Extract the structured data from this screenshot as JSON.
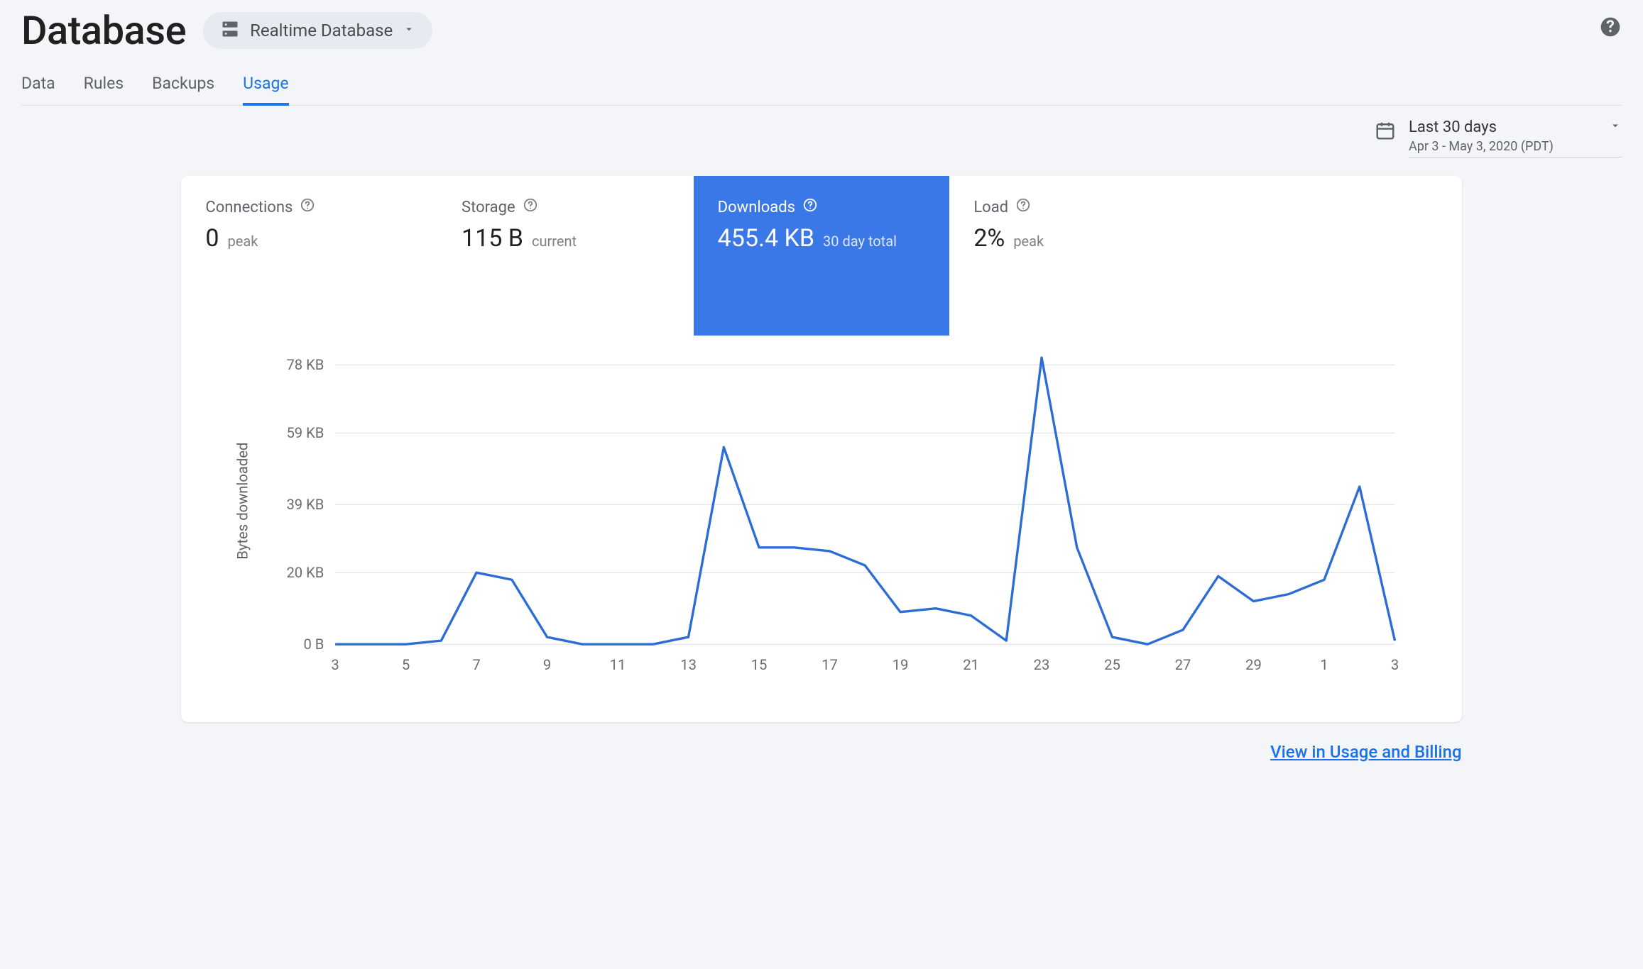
{
  "header": {
    "title": "Database",
    "picker_label": "Realtime Database"
  },
  "tabs": [
    {
      "label": "Data",
      "active": false
    },
    {
      "label": "Rules",
      "active": false
    },
    {
      "label": "Backups",
      "active": false
    },
    {
      "label": "Usage",
      "active": true
    }
  ],
  "date_range": {
    "main": "Last 30 days",
    "sub": "Apr 3 - May 3, 2020 (PDT)"
  },
  "metrics": [
    {
      "key": "connections",
      "label": "Connections",
      "value": "0",
      "sub": "peak",
      "selected": false
    },
    {
      "key": "storage",
      "label": "Storage",
      "value": "115 B",
      "sub": "current",
      "selected": false
    },
    {
      "key": "downloads",
      "label": "Downloads",
      "value": "455.4 KB",
      "sub": "30 day total",
      "selected": true
    },
    {
      "key": "load",
      "label": "Load",
      "value": "2%",
      "sub": "peak",
      "selected": false
    }
  ],
  "footer_link": "View in Usage and Billing",
  "chart_data": {
    "type": "line",
    "title": "",
    "ylabel": "Bytes downloaded",
    "xlabel": "",
    "ylim": [
      0,
      80
    ],
    "y_ticks": [
      {
        "v": 0,
        "label": "0 B"
      },
      {
        "v": 20,
        "label": "20 KB"
      },
      {
        "v": 39,
        "label": "39 KB"
      },
      {
        "v": 59,
        "label": "59 KB"
      },
      {
        "v": 78,
        "label": "78 KB"
      }
    ],
    "x_ticks": [
      "3",
      "5",
      "7",
      "9",
      "11",
      "13",
      "15",
      "17",
      "19",
      "21",
      "23",
      "25",
      "27",
      "29",
      "1",
      "3"
    ],
    "x": [
      "3",
      "4",
      "5",
      "6",
      "7",
      "8",
      "9",
      "10",
      "11",
      "12",
      "13",
      "14",
      "15",
      "16",
      "17",
      "18",
      "19",
      "20",
      "21",
      "22",
      "23",
      "24",
      "25",
      "26",
      "27",
      "28",
      "29",
      "30",
      "1",
      "2",
      "3"
    ],
    "values_kb": [
      0,
      0,
      0,
      1,
      20,
      18,
      2,
      0,
      0,
      0,
      2,
      55,
      27,
      27,
      26,
      22,
      9,
      10,
      8,
      1,
      80,
      27,
      2,
      0,
      4,
      19,
      12,
      14,
      18,
      44,
      1
    ]
  }
}
